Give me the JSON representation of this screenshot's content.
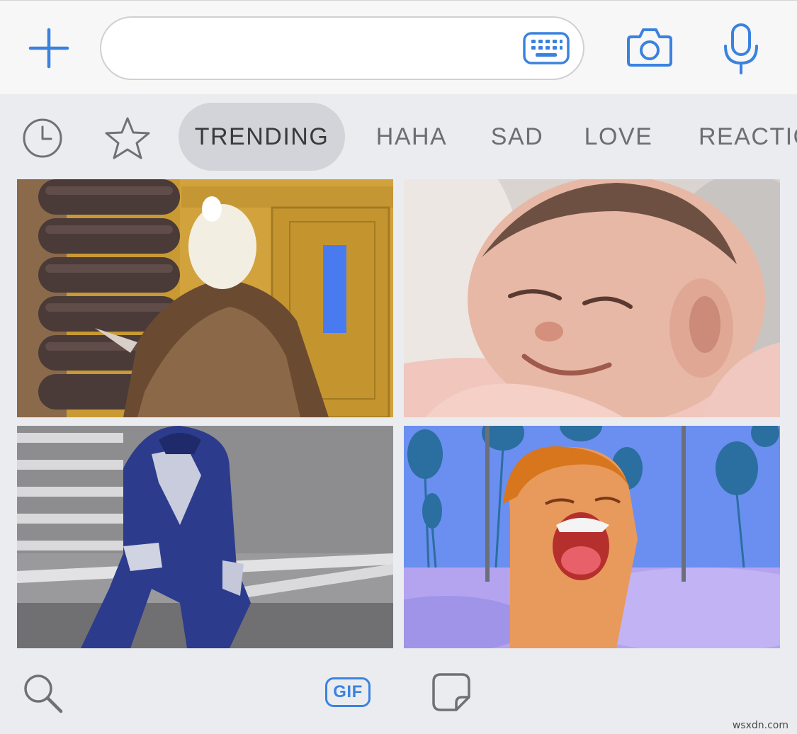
{
  "compose": {
    "message_value": "",
    "message_placeholder": "",
    "icons": {
      "plus": "plus-icon",
      "keyboard": "keyboard-icon",
      "camera": "camera-icon",
      "microphone": "microphone-icon"
    }
  },
  "categories": {
    "icons": {
      "recent": "clock-icon",
      "favorites": "star-icon"
    },
    "tabs": [
      "TRENDING",
      "HAHA",
      "SAD",
      "LOVE",
      "REACTIONS"
    ],
    "active_tab": "TRENDING"
  },
  "gifs": [
    {
      "subject": "bird-in-doorway"
    },
    {
      "subject": "smiling-baby"
    },
    {
      "subject": "blue-costume-dancer"
    },
    {
      "subject": "laughing-man"
    }
  ],
  "bottom_bar": {
    "gif_label": "GIF",
    "icons": {
      "search": "search-icon",
      "gif": "gif-icon",
      "sticker": "sticker-icon"
    }
  },
  "watermark": "wsxdn.com",
  "colors": {
    "accent": "#3b82e0",
    "tab_text": "#6d6d72",
    "active_tab_bg": "#d3d4d9",
    "background": "#ebecf0"
  }
}
